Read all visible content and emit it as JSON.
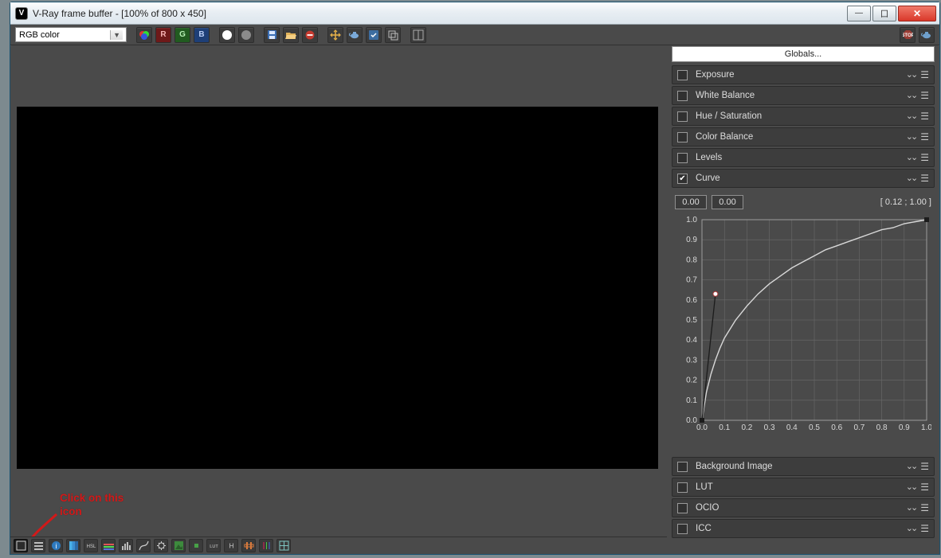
{
  "window": {
    "title": "V-Ray frame buffer - [100% of 800 x 450]"
  },
  "toolbar": {
    "channel_combo": "RGB color",
    "btn_R": "R",
    "btn_G": "G",
    "btn_B": "B"
  },
  "annotation": {
    "line1": "Click on this",
    "line2": "icon"
  },
  "sidepanel": {
    "globals_label": "Globals...",
    "sections": [
      {
        "key": "exposure",
        "label": "Exposure",
        "checked": false
      },
      {
        "key": "wb",
        "label": "White Balance",
        "checked": false
      },
      {
        "key": "hsl",
        "label": "Hue / Saturation",
        "checked": false
      },
      {
        "key": "cb",
        "label": "Color Balance",
        "checked": false
      },
      {
        "key": "levels",
        "label": "Levels",
        "checked": false
      },
      {
        "key": "curve",
        "label": "Curve",
        "checked": true
      }
    ],
    "curve": {
      "in_a": "0.00",
      "in_b": "0.00",
      "coord": "[ 0.12 ; 1.00 ]"
    },
    "sections2": [
      {
        "key": "bg",
        "label": "Background Image",
        "checked": false
      },
      {
        "key": "lut",
        "label": "LUT",
        "checked": false
      },
      {
        "key": "ocio",
        "label": "OCIO",
        "checked": false
      },
      {
        "key": "icc",
        "label": "ICC",
        "checked": false
      }
    ]
  },
  "chart_data": {
    "type": "line",
    "title": "",
    "xlabel": "",
    "ylabel": "",
    "xlim": [
      0.0,
      1.0
    ],
    "ylim": [
      0.0,
      1.0
    ],
    "xticks": [
      0.0,
      0.1,
      0.2,
      0.3,
      0.4,
      0.5,
      0.6,
      0.7,
      0.8,
      0.9,
      1.0
    ],
    "yticks": [
      0.0,
      0.1,
      0.2,
      0.3,
      0.4,
      0.5,
      0.6,
      0.7,
      0.8,
      0.9,
      1.0
    ],
    "series": [
      {
        "name": "curve",
        "x": [
          0.0,
          0.02,
          0.04,
          0.06,
          0.08,
          0.1,
          0.15,
          0.2,
          0.25,
          0.3,
          0.35,
          0.4,
          0.45,
          0.5,
          0.55,
          0.6,
          0.65,
          0.7,
          0.75,
          0.8,
          0.85,
          0.9,
          0.95,
          1.0
        ],
        "y": [
          0.0,
          0.14,
          0.23,
          0.3,
          0.36,
          0.41,
          0.5,
          0.57,
          0.63,
          0.68,
          0.72,
          0.76,
          0.79,
          0.82,
          0.85,
          0.87,
          0.89,
          0.91,
          0.93,
          0.95,
          0.96,
          0.98,
          0.99,
          1.0
        ]
      }
    ],
    "handles": [
      {
        "x": 0.0,
        "y": 0.0
      },
      {
        "x": 1.0,
        "y": 1.0
      }
    ],
    "control_point": {
      "x": 0.06,
      "y": 0.63
    }
  }
}
